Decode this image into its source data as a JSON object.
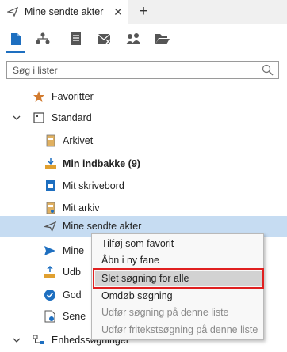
{
  "tab": {
    "title": "Mine sendte akter",
    "close": "✕",
    "add": "+"
  },
  "toolbar": {
    "items": [
      {
        "name": "documents-icon",
        "color": "#1e6fc0"
      },
      {
        "name": "org-chart-icon",
        "color": "#555555"
      },
      {
        "name": "register-icon",
        "color": "#555555"
      },
      {
        "name": "mail-x-icon",
        "color": "#555555"
      },
      {
        "name": "people-icon",
        "color": "#555555"
      },
      {
        "name": "folder-open-icon",
        "color": "#555555"
      }
    ]
  },
  "search": {
    "placeholder": "Søg i lister",
    "value": ""
  },
  "tree": {
    "favorites": "Favoritter",
    "standard": "Standard",
    "items": {
      "arkivet": "Arkivet",
      "indbakke": "Min indbakke (9)",
      "skrivebord": "Mit skrivebord",
      "arkiv": "Mit arkiv",
      "sendte": "Mine sendte akter",
      "mine_partial": "Mine",
      "udb_partial": "Udb",
      "god_partial": "God",
      "sene_partial": "Sene"
    },
    "enhed": "Enhedssøgninger"
  },
  "context_menu": {
    "items": [
      {
        "label": "Tilføj som favorit",
        "enabled": true
      },
      {
        "label": "Åbn i ny fane",
        "enabled": true
      },
      {
        "label": "Slet søgning for alle",
        "enabled": true
      },
      {
        "label": "Omdøb søgning",
        "enabled": true
      },
      {
        "label": "Udfør søgning på denne liste",
        "enabled": false
      },
      {
        "label": "Udfør fritekstsøgning på denne liste",
        "enabled": false
      }
    ]
  },
  "colors": {
    "accent": "#1e6fc0",
    "selection": "#c6dcf2",
    "highlight_outline": "#e02020"
  }
}
